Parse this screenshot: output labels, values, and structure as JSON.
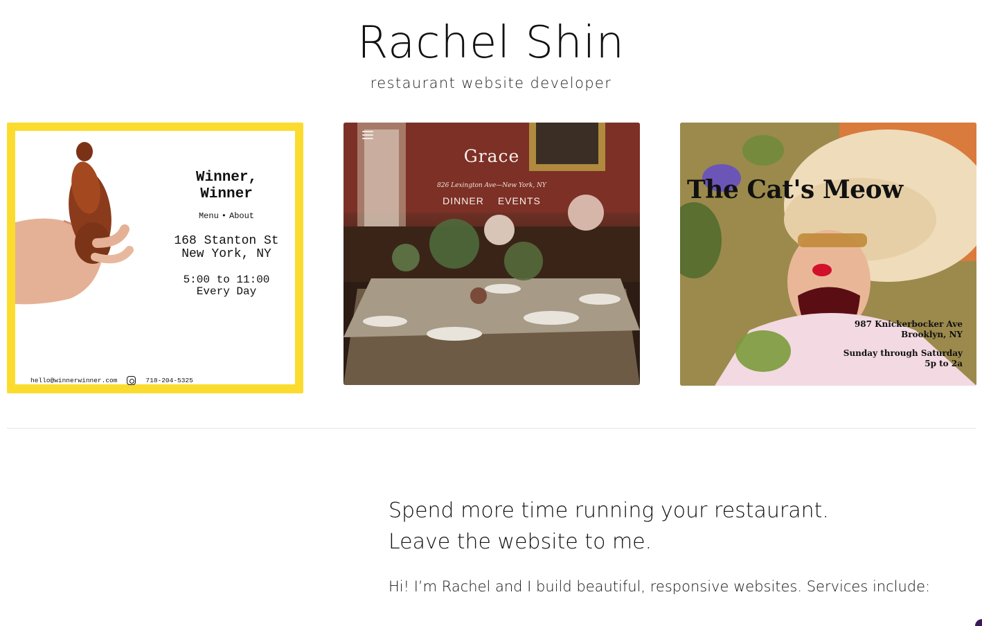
{
  "header": {
    "title": "Rachel Shin",
    "subtitle": "restaurant website developer"
  },
  "portfolio": {
    "winner": {
      "title_line1": "Winner,",
      "title_line2": "Winner",
      "nav_menu": "Menu",
      "nav_sep": "•",
      "nav_about": "About",
      "address_line1": "168 Stanton St",
      "address_line2": "New York, NY",
      "hours_line1": "5:00 to 11:00",
      "hours_line2": "Every Day",
      "email": "hello@winnerwinner.com",
      "phone": "718-204-5325",
      "accent_color": "#fbdc2e"
    },
    "grace": {
      "title": "Grace",
      "address": "826 Lexington Ave—New York, NY",
      "nav_dinner": "DINNER",
      "nav_events": "EVENTS"
    },
    "cat": {
      "title": "The Cat's Meow",
      "address_line1": "987 Knickerbocker Ave",
      "address_line2": "Brooklyn, NY",
      "hours_line1": "Sunday through Saturday",
      "hours_line2": "5p to 2a"
    }
  },
  "pitch": {
    "headline_line1": "Spend more time running your restaurant.",
    "headline_line2": "Leave the website to me.",
    "body": "Hi! I’m Rachel and I build beautiful, responsive websites. Services include:"
  }
}
